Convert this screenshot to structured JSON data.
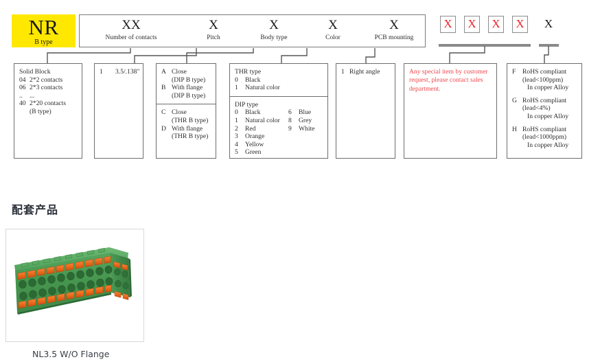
{
  "logo": {
    "brand": "NR",
    "subtitle": "B type",
    "bg_color": "#ffe800"
  },
  "code_bar": {
    "segments": [
      {
        "code": "XX",
        "label": "Number of contacts"
      },
      {
        "code": "X",
        "label": "Pitch"
      },
      {
        "code": "X",
        "label": "Body type"
      },
      {
        "code": "X",
        "label": "Color"
      },
      {
        "code": "X",
        "label": "PCB mounting"
      }
    ],
    "special_boxes": [
      "X",
      "X",
      "X",
      "X"
    ],
    "special_box_color": "#e8272c",
    "final_box": "X"
  },
  "details": {
    "contacts": {
      "heading": "Solid Block",
      "rows": [
        {
          "key": "04",
          "val": "2*2 contacts"
        },
        {
          "key": "06",
          "val": "2*3 contacts"
        },
        {
          "key": "..",
          "val": "..."
        },
        {
          "key": "40",
          "val": "2*20 contacts"
        }
      ],
      "note": "(B type)"
    },
    "pitch": {
      "rows": [
        {
          "key": "1",
          "val": "3.5/.138\""
        }
      ]
    },
    "body_type": {
      "group_dip": [
        {
          "key": "A",
          "val": "Close",
          "sub": "(DIP B type)"
        },
        {
          "key": "B",
          "val": "With flange",
          "sub": "(DIP B type)"
        }
      ],
      "group_thr": [
        {
          "key": "C",
          "val": "Close",
          "sub": "(THR B type)"
        },
        {
          "key": "D",
          "val": "With flange",
          "sub": "(THR B type)"
        }
      ]
    },
    "color": {
      "thr_heading": "THR type",
      "thr_rows": [
        {
          "key": "0",
          "val": "Black"
        },
        {
          "key": "1",
          "val": "Natural color"
        }
      ],
      "dip_heading": "DIP type",
      "dip_rows_left": [
        {
          "key": "0",
          "val": "Black"
        },
        {
          "key": "1",
          "val": "Natural color"
        },
        {
          "key": "2",
          "val": "Red"
        },
        {
          "key": "3",
          "val": "Orange"
        },
        {
          "key": "4",
          "val": "Yellow"
        },
        {
          "key": "5",
          "val": "Green"
        }
      ],
      "dip_rows_right": [
        {
          "key": "6",
          "val": "Blue"
        },
        {
          "key": "8",
          "val": "Grey"
        },
        {
          "key": "9",
          "val": "White"
        }
      ]
    },
    "pcb_mounting": {
      "rows": [
        {
          "key": "1",
          "val": "Right angle"
        }
      ]
    },
    "special_item": {
      "text": "Any special item by customer request, please contact sales department.",
      "color": "#f0474c"
    },
    "rohs": {
      "entries": [
        {
          "key": "F",
          "line1": "RoHS compliant",
          "line2": "(lead<100ppm)",
          "line3": "In copper Alloy"
        },
        {
          "key": "G",
          "line1": "RoHS compliant",
          "line2": "(lead<4%)",
          "line3": "In copper Alloy"
        },
        {
          "key": "H",
          "line1": "RoHS compliant",
          "line2": "(lead<1000ppm)",
          "line3": "In copper Alloy"
        }
      ]
    }
  },
  "lower_section": {
    "title": "配套产品",
    "product_caption": "NL3.5 W/O Flange",
    "product_colors": {
      "body_green": "#4a9c53",
      "lever_orange": "#e8661a"
    }
  }
}
